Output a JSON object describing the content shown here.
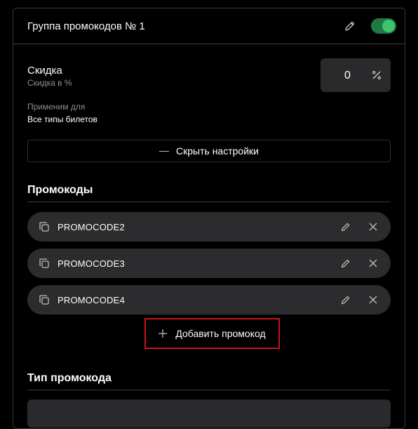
{
  "header": {
    "title": "Группа промокодов № 1",
    "enabled": true
  },
  "discount": {
    "title": "Скидка",
    "subtitle": "Скидка в %",
    "value": "0",
    "unit_icon": "percent-icon"
  },
  "applied": {
    "label": "Применим для",
    "value": "Все типы билетов"
  },
  "hide_settings_label": "Скрыть настройки",
  "promocodes": {
    "title": "Промокоды",
    "items": [
      {
        "code": "PROMOCODE2"
      },
      {
        "code": "PROMOCODE3"
      },
      {
        "code": "PROMOCODE4"
      }
    ],
    "add_label": "Добавить промокод"
  },
  "promo_type": {
    "title": "Тип промокода"
  },
  "colors": {
    "background": "#000000",
    "surface": "#2c2c2e",
    "toggle_on": "#3ec46d",
    "highlight": "#c4161c"
  }
}
